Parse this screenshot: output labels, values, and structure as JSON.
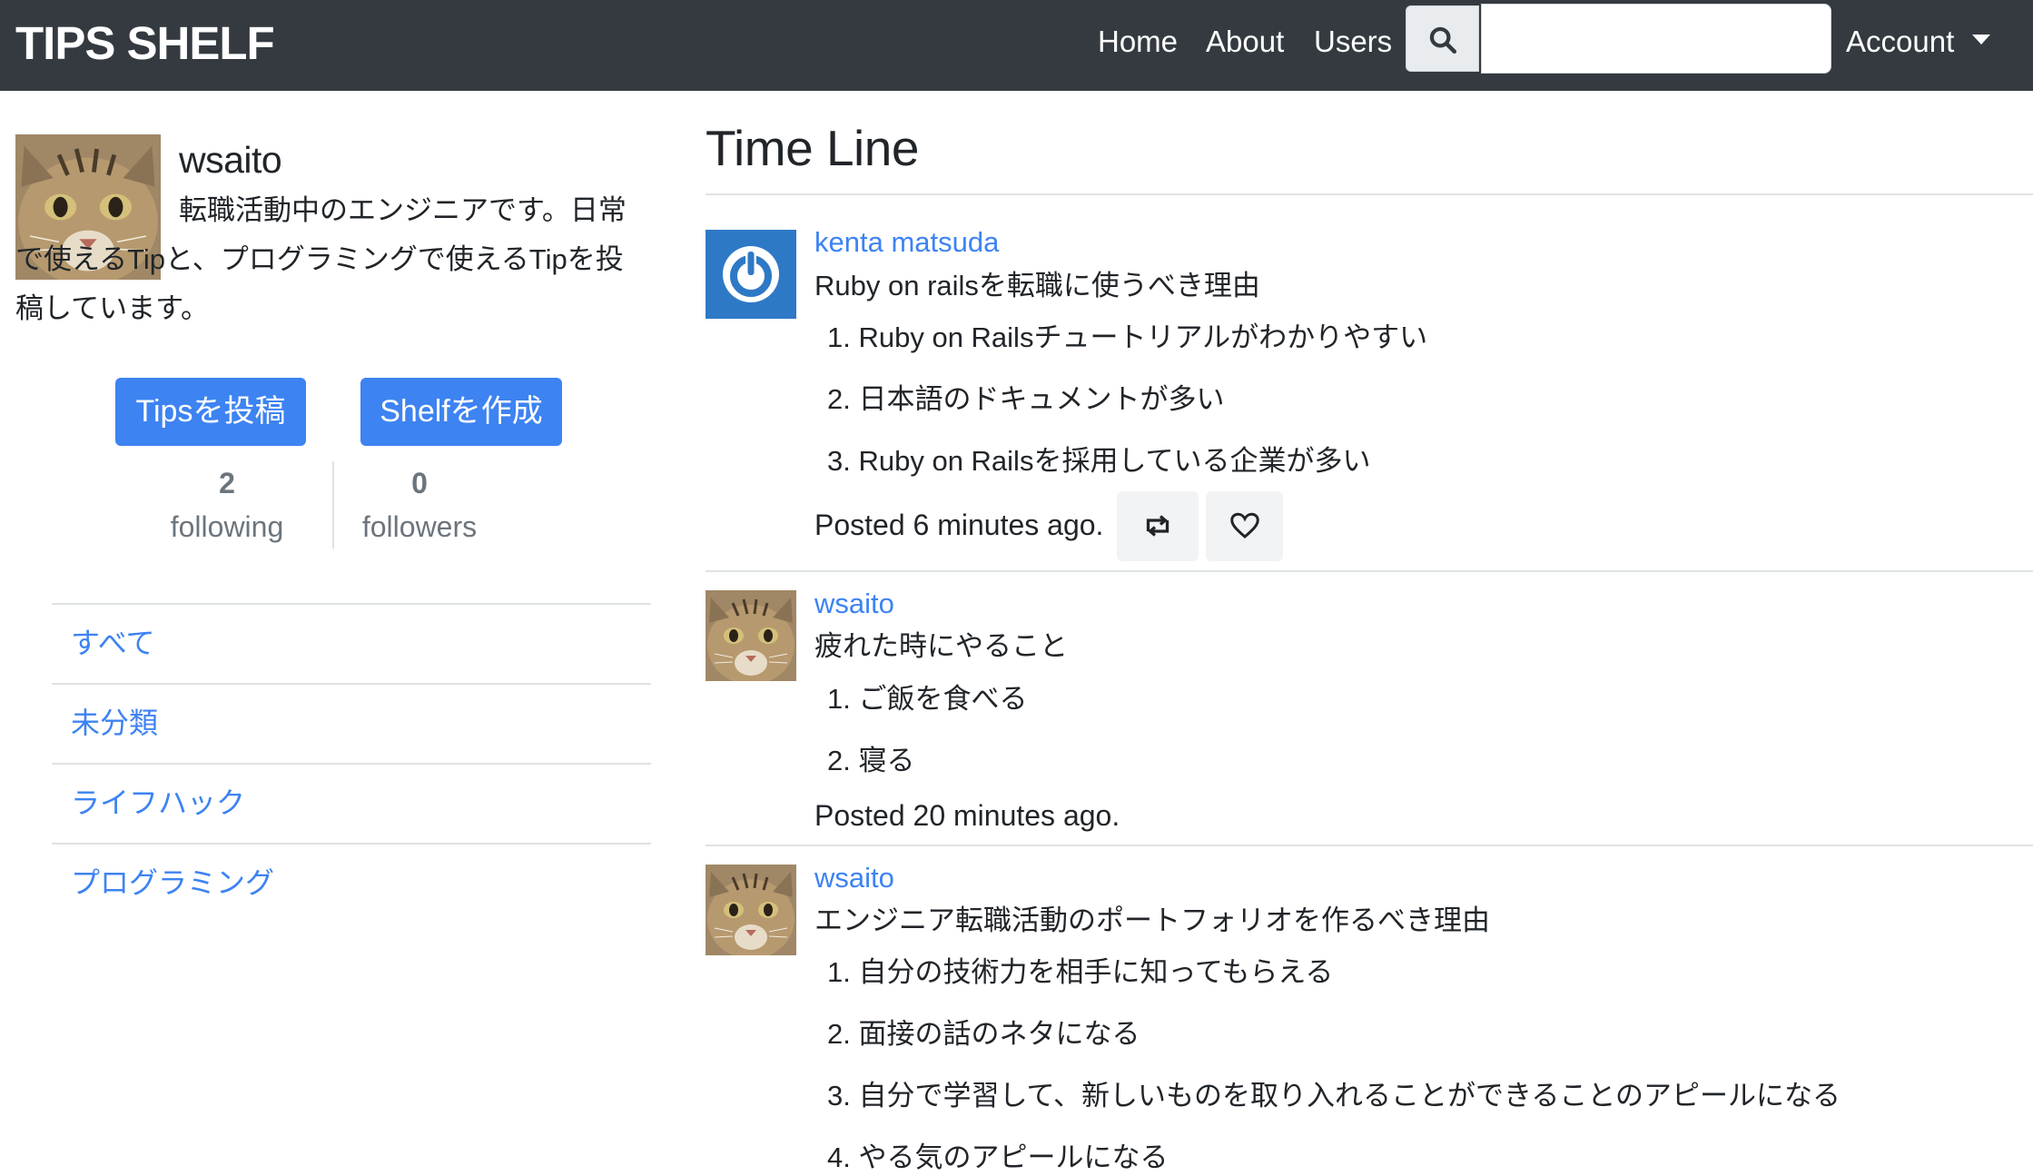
{
  "navbar": {
    "brand": "TIPS SHELF",
    "links": [
      "Home",
      "About",
      "Users"
    ],
    "search": {
      "icon": "search-icon",
      "value": "",
      "placeholder": ""
    },
    "account": "Account"
  },
  "profile": {
    "name": "wsaito",
    "bio": "転職活動中のエンジニアです。日常で使えるTipと、プログラミングで使えるTipを投稿しています。",
    "buttons": {
      "post_tip": "Tipsを投稿",
      "create_shelf": "Shelfを作成"
    },
    "following_count": "2",
    "following_label": "following",
    "followers_count": "0",
    "followers_label": "followers",
    "categories": [
      "すべて",
      "未分類",
      "ライフハック",
      "プログラミング"
    ]
  },
  "timeline": {
    "title": "Time Line",
    "posts": [
      {
        "author": "kenta matsuda",
        "title": "Ruby on railsを転職に使うべき理由",
        "items": [
          "1. Ruby on Railsチュートリアルがわかりやすい",
          "2. 日本語のドキュメントが多い",
          "3. Ruby on Railsを採用している企業が多い"
        ],
        "time": "Posted 6 minutes ago.",
        "actions": [
          "retweet-icon",
          "heart-icon"
        ]
      },
      {
        "author": "wsaito",
        "title": "疲れた時にやること",
        "items": [
          "1. ご飯を食べる",
          "2. 寝る"
        ],
        "time": "Posted 20 minutes ago."
      },
      {
        "author": "wsaito",
        "title": "エンジニア転職活動のポートフォリオを作るべき理由",
        "items": [
          "1. 自分の技術力を相手に知ってもらえる",
          "2. 面接の話のネタになる",
          "3. 自分で学習して、新しいものを取り入れることができることのアピールになる",
          "4. やる気のアピールになる"
        ]
      }
    ]
  },
  "colors": {
    "navbar": "#343a40",
    "primary": "#3d83f2",
    "link": "#3d83f2",
    "muted": "#6c757d"
  }
}
